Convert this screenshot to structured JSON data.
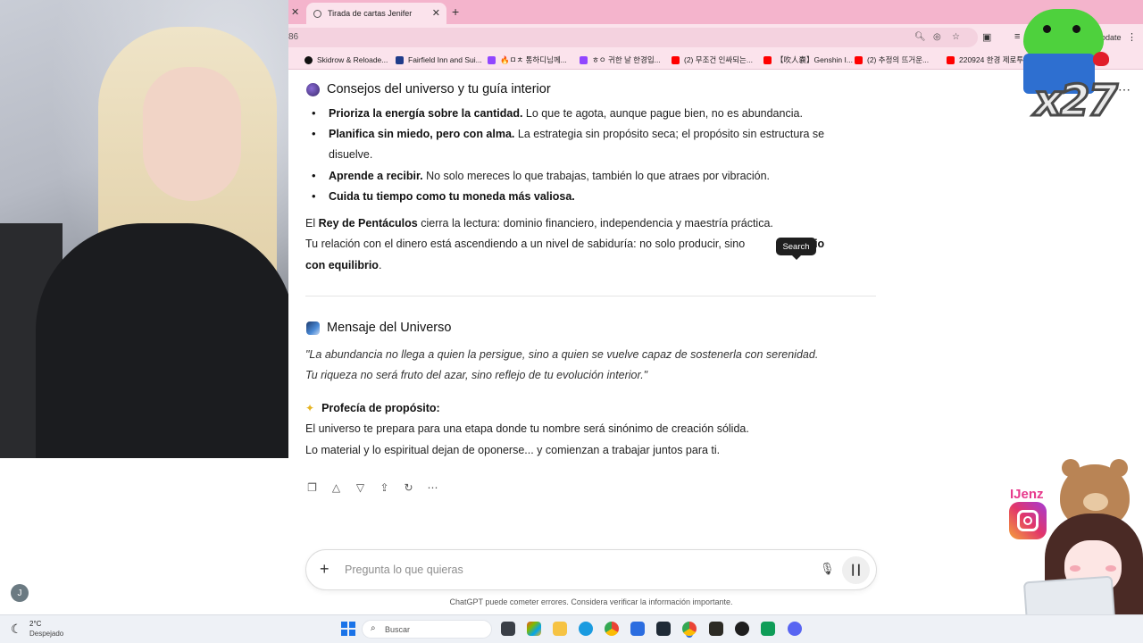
{
  "browser": {
    "tab_title": "Tirada de cartas Jenifer",
    "tab_close": "✕",
    "left_close": "✕",
    "new_tab": "+",
    "url_fragment": "86",
    "update_label": "odate"
  },
  "bookmarks": [
    {
      "label": "Skidrow & Reloade...",
      "color": "#111111"
    },
    {
      "label": "Fairfield Inn and Sui...",
      "color": "#1f3b8a"
    },
    {
      "label": "🔥ㅁㅊ 통하디님께...",
      "color": "#9146ff"
    },
    {
      "label": "ㅎㅇ 귀한 날 한경입...",
      "color": "#9146ff"
    },
    {
      "label": "(2) 무조건 인싸되는...",
      "color": "#ff0000"
    },
    {
      "label": "【吹人嚢】Genshin I...",
      "color": "#ff0000"
    },
    {
      "label": "(2) 추정의 뜨거운...",
      "color": "#ff0000"
    },
    {
      "label": "220924 한경 제로투...",
      "color": "#ff0000"
    }
  ],
  "section1": {
    "heading": "Consejos del universo y tu guía interior",
    "bullets": [
      {
        "bold": "Prioriza la energía sobre la cantidad.",
        "rest": " Lo que te agota, aunque pague bien, no es abundancia."
      },
      {
        "bold": "Planifica sin miedo, pero con alma.",
        "rest": " La estrategia sin propósito seca; el propósito sin estructura se"
      },
      {
        "bold": "Aprende a recibir.",
        "rest": " No solo mereces lo que trabajas, también lo que atraes por vibración."
      },
      {
        "bold": "Cuida tu tiempo como tu moneda más valiosa.",
        "rest": ""
      }
    ],
    "bullet2_cont": "disuelve.",
    "para1_pre": "El ",
    "para1_bold": "Rey de Pentáculos",
    "para1_post": " cierra la lectura: dominio financiero, independencia y maestría práctica.",
    "para2_pre": "Tu relación con el dinero está ascendiendo a un nivel de sabiduría: no solo producir, sino ",
    "para2_bold_end": "r imperio",
    "para3_bold": "con equilibrio",
    "para3_post": "."
  },
  "tooltip": "Search",
  "section2": {
    "heading": "Mensaje del Universo",
    "quote_line1": "\"La abundancia no llega a quien la persigue, sino a quien se vuelve capaz de sostenerla con serenidad.",
    "quote_line2": "Tu riqueza no será fruto del azar, sino reflejo de tu evolución interior.\"",
    "prophecy_label": "Profecía de propósito:",
    "prophecy_line1": "El universo te prepara para una etapa donde tu nombre será sinónimo de creación sólida.",
    "prophecy_line2": "Lo material y lo espiritual dejan de oponerse... y comienzan a trabajar juntos para ti."
  },
  "composer": {
    "placeholder": "Pregunta lo que quieras",
    "disclaimer": "ChatGPT puede cometer errores. Considera verificar la información importante."
  },
  "user_initial": "J",
  "taskbar": {
    "temp": "2°C",
    "weather": "Despejado",
    "search_label": "Buscar"
  },
  "overlay": {
    "counter": "x27",
    "ig_handle": "IJenz"
  },
  "colors": {
    "tabstrip": "#f4b4cc",
    "toolbar": "#fbe3ec",
    "accent": "#1a73e8"
  }
}
